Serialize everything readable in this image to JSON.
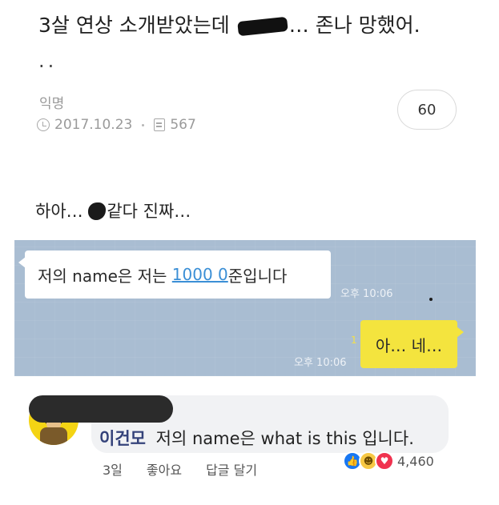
{
  "post": {
    "title_part1": "3살 연상 소개받았는데",
    "title_part2": "… 존나 망했어.",
    "title_cont": "..",
    "author": "익명",
    "date": "2017.10.23",
    "views": "567",
    "comment_count": "60",
    "body_part1": "하아…",
    "body_part2": "같다 진짜…"
  },
  "chat": {
    "msg_in_prefix": "저의 name은 저는 ",
    "msg_in_link": "1000 0",
    "msg_in_suffix": "준입니다",
    "time_in": "오후 10:06",
    "read_count": "1",
    "time_out": "오후 10:06",
    "msg_out": "아… 네…"
  },
  "comment": {
    "name": "이건모",
    "text": "저의 name은 what is this 입니다.",
    "age": "3일",
    "like_label": "좋아요",
    "reply_label": "답글 달기",
    "reaction_count": "4,460",
    "reaction_icons": [
      "like-icon",
      "haha-icon",
      "love-icon"
    ]
  },
  "colors": {
    "chat_bg": "#a9bdd2",
    "bubble_out": "#f4e43e",
    "link": "#3b8fd6",
    "like": "#1877f2",
    "love": "#f0324f"
  }
}
